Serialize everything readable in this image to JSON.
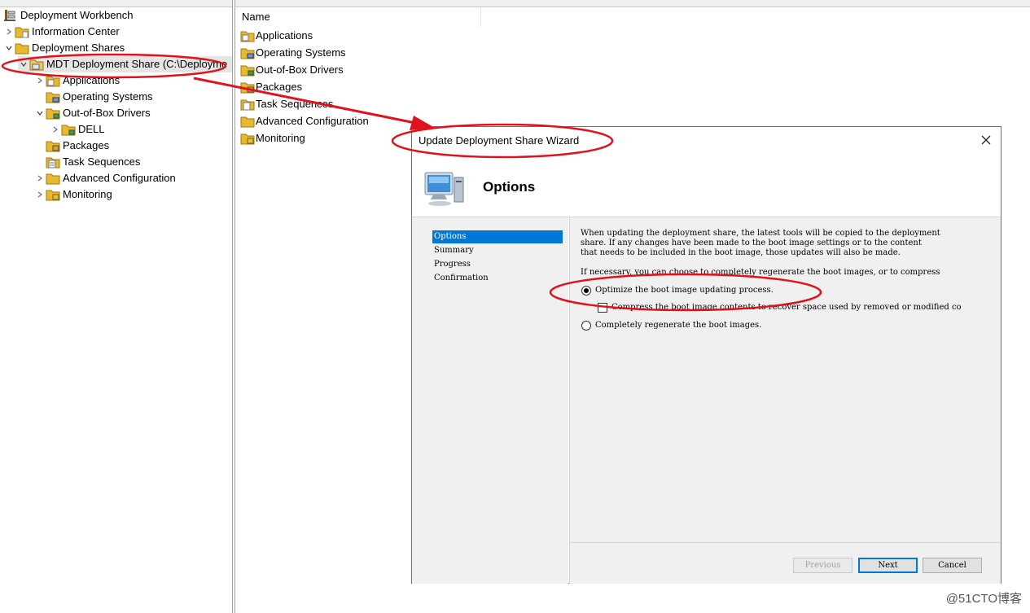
{
  "tree": {
    "root_label": "Deployment Workbench",
    "items": [
      {
        "label": "Information Center"
      },
      {
        "label": "Deployment Shares"
      },
      {
        "label": "MDT Deployment Share (C:\\Deployme"
      },
      {
        "label": "Applications"
      },
      {
        "label": "Operating Systems"
      },
      {
        "label": "Out-of-Box Drivers"
      },
      {
        "label": "DELL"
      },
      {
        "label": "Packages"
      },
      {
        "label": "Task Sequences"
      },
      {
        "label": "Advanced Configuration"
      },
      {
        "label": "Monitoring"
      }
    ]
  },
  "list": {
    "column_name": "Name",
    "items": [
      {
        "label": "Applications"
      },
      {
        "label": "Operating Systems"
      },
      {
        "label": "Out-of-Box Drivers"
      },
      {
        "label": "Packages"
      },
      {
        "label": "Task Sequences"
      },
      {
        "label": "Advanced Configuration"
      },
      {
        "label": "Monitoring"
      }
    ]
  },
  "dialog": {
    "title": "Update Deployment Share Wizard",
    "heading": "Options",
    "steps": [
      {
        "label": "Options"
      },
      {
        "label": "Summary"
      },
      {
        "label": "Progress"
      },
      {
        "label": "Confirmation"
      }
    ],
    "description": [
      "When updating the deployment share, the latest tools will be copied to the deployment",
      "share.  If any changes have been made to the boot image settings or to the content",
      "that needs to be included in the boot image, those updates will also be made."
    ],
    "note": "If necessary, you can choose to completely regenerate the boot images, or to compress",
    "option_optimize": "Optimize the boot image updating process.",
    "option_compress": "Compress the boot image contents to recover space used by removed or modified co",
    "option_regenerate": "Completely regenerate the boot images.",
    "buttons": {
      "previous": "Previous",
      "next": "Next",
      "cancel": "Cancel"
    }
  },
  "watermark": "@51CTO博客",
  "colors": {
    "selection": "#0078d7",
    "annotation": "#e0121b",
    "folder": "#e8b830"
  },
  "icons": {
    "folder": "folder-icon",
    "workbench": "workbench-icon",
    "computer": "computer-icon",
    "close": "close-icon"
  }
}
